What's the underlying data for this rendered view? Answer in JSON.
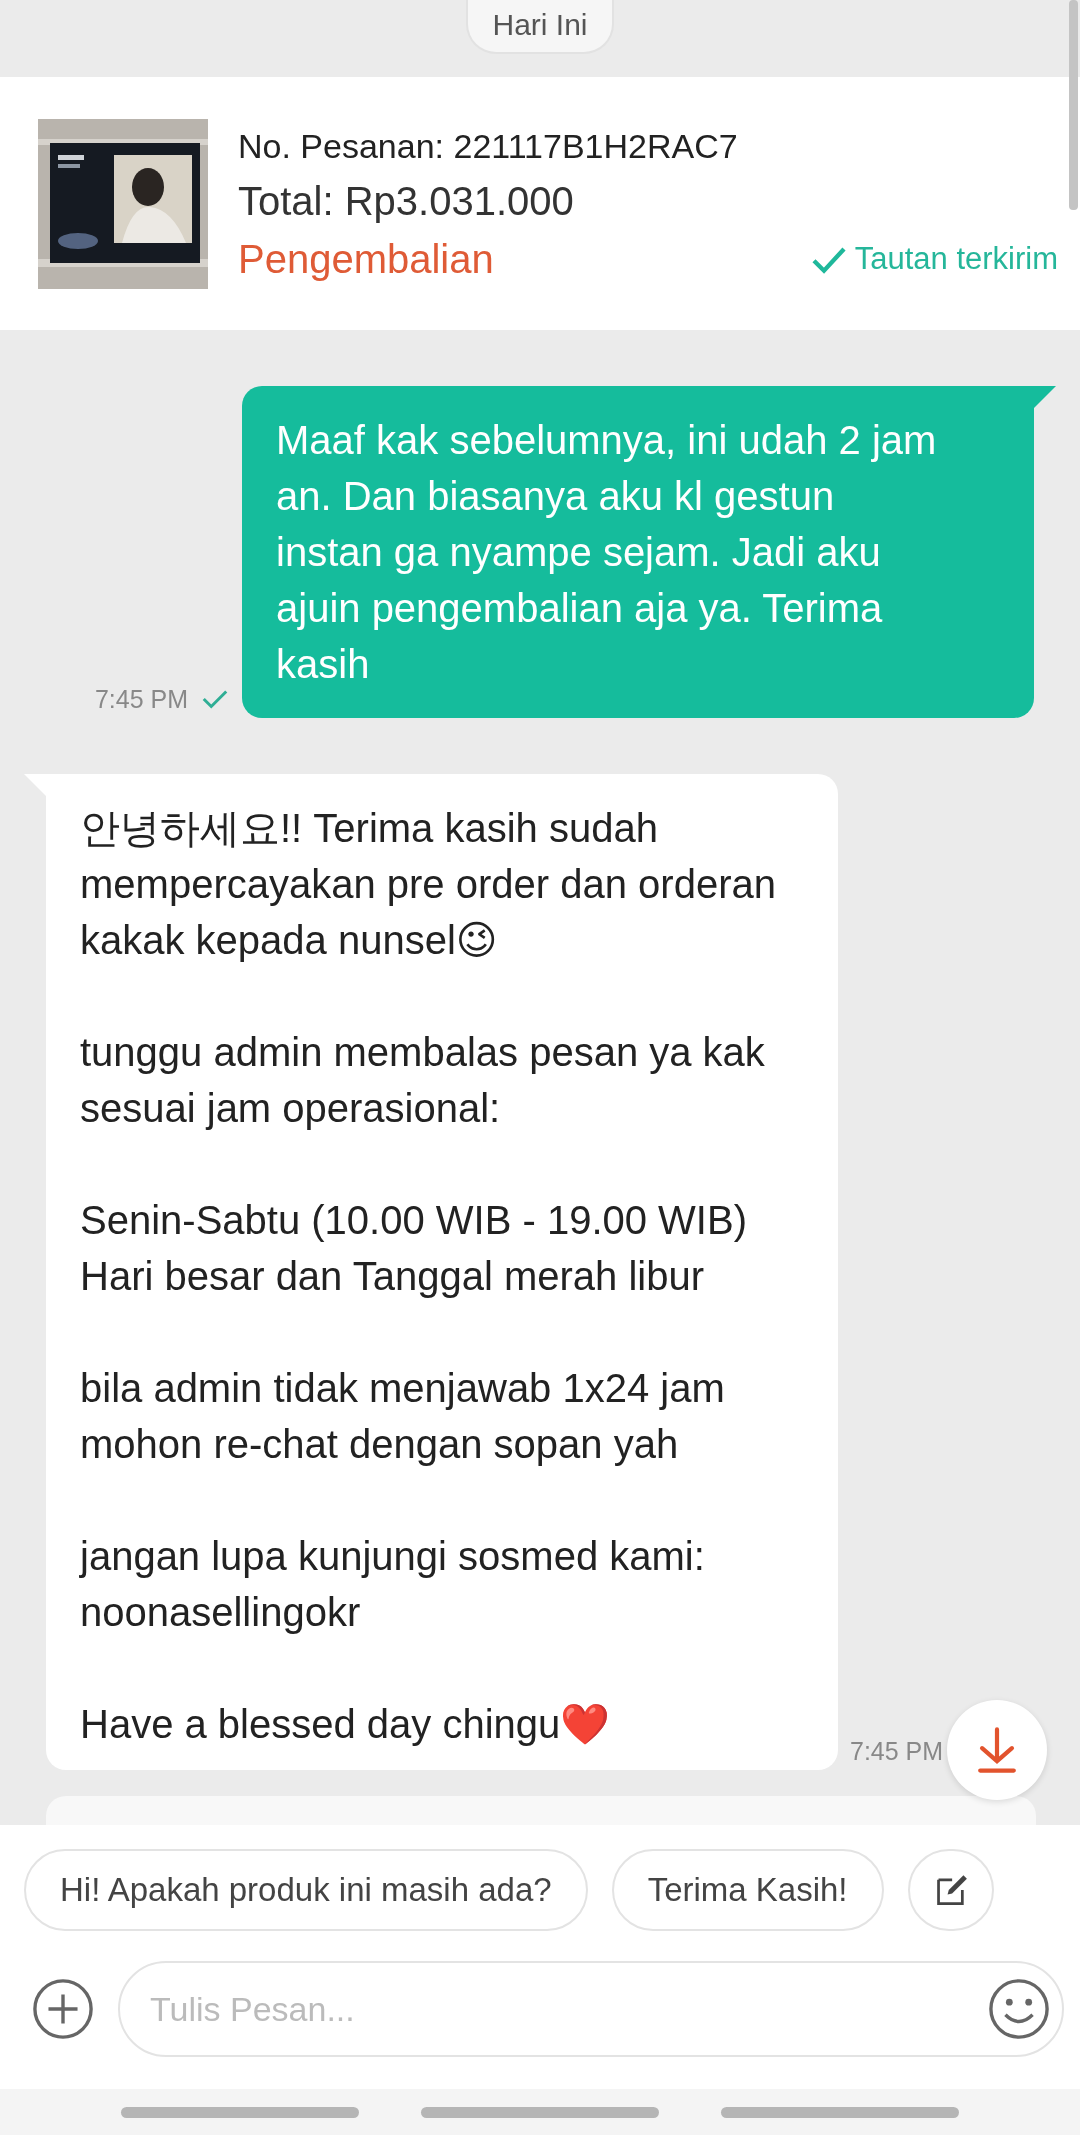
{
  "date_label": "Hari Ini",
  "order": {
    "kind": "picture",
    "number": "No. Pesanan: 221117B1H2RAC7",
    "total": "Total: Rp3.031.000",
    "status": "Pengembalian",
    "link_status": "Tautan terkirim",
    "link_sent": true
  },
  "messages": [
    {
      "kind": "outgoing",
      "paragraphs": [
        "Maaf kak sebelumnya, ini udah 2 jam an. Dan biasanya aku kl gestun instan ga nyampe sejam. Jadi aku ajuin pengembalian aja ya. Terima kasih"
      ],
      "time": "7:45 PM",
      "delivered": true
    },
    {
      "kind": "incoming",
      "paragraphs": [
        "안녕하세요!! Terima kasih sudah mempercayakan pre order dan orderan kakak kepada nunsel😉",
        "tunggu admin membalas pesan ya kak sesuai jam operasional:",
        "Senin-Sabtu (10.00 WIB - 19.00 WIB)\nHari besar dan Tanggal merah libur",
        "bila admin tidak menjawab 1x24 jam mohon re-chat dengan sopan yah",
        "jangan lupa kunjungi sosmed kami: noonasellingokr",
        "Have a blessed day chingu❤️"
      ],
      "time": "7:45 PM"
    }
  ],
  "quick_replies": [
    "Hi! Apakah produk ini masih ada?",
    "Terima Kasih!"
  ],
  "composer": {
    "placeholder": "Tulis Pesan..."
  }
}
